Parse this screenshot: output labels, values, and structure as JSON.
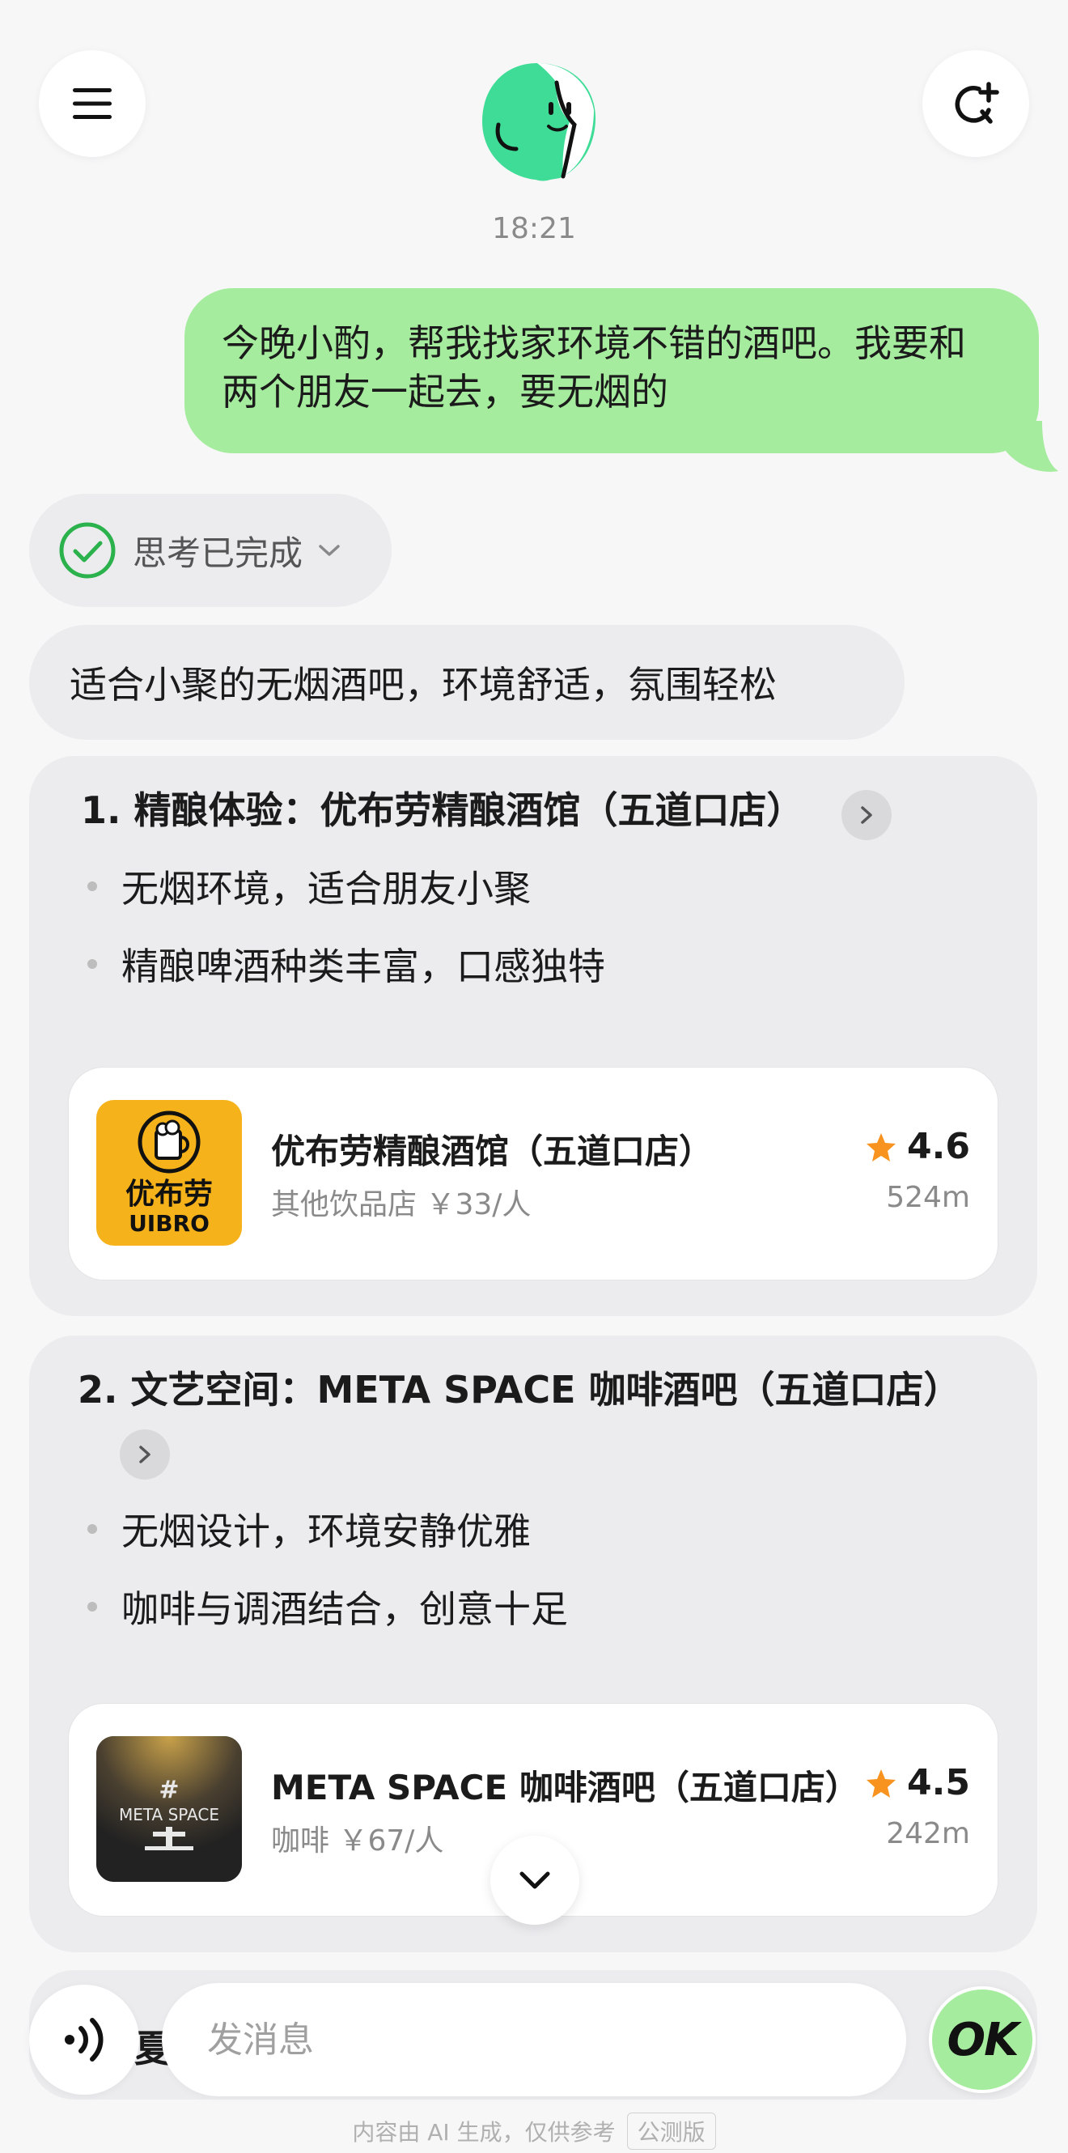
{
  "header": {
    "menu_icon": "hamburger-menu-icon",
    "new_chat_icon": "new-chat-refresh-icon",
    "avatar_icon": "assistant-avatar-icon",
    "timestamp": "18:21"
  },
  "chat": {
    "user_message": "今晚小酌，帮我找家环境不错的酒吧。我要和两个朋友一起去，要无烟的",
    "thinking_status": "思考已完成",
    "summary": "适合小聚的无烟酒吧，环境舒适，氛围轻松",
    "recommendations": [
      {
        "title": "1. 精酿体验：优布劳精酿酒馆（五道口店）",
        "bullets": [
          "无烟环境，适合朋友小聚",
          "精酿啤酒种类丰富，口感独特"
        ],
        "place": {
          "name": "优布劳精酿酒馆（五道口店）",
          "meta": "其他饮品店 ￥33/人",
          "rating": "4.6",
          "distance": "524m",
          "logo_text_cn": "优布劳",
          "logo_text_en": "UIBRO"
        }
      },
      {
        "title_line1": "2. 文艺空间：META SPACE 咖啡酒吧（五道口店）",
        "bullets": [
          "无烟设计，环境安静优雅",
          "咖啡与调酒结合，创意十足"
        ],
        "place": {
          "name": "META SPACE 咖啡酒吧（五道口店）",
          "meta": "咖啡 ￥67/人",
          "rating": "4.5",
          "distance": "242m",
          "logo_text": "META SPACE"
        }
      }
    ],
    "partial_text": "夏"
  },
  "composer": {
    "placeholder": "发消息",
    "send_label": "OK"
  },
  "footer": {
    "disclaimer": "内容由 AI 生成，仅供参考",
    "badge": "公测版"
  },
  "colors": {
    "bubble_green": "#a6ec9e",
    "card_gray": "#ececef",
    "star_orange": "#f7931e",
    "check_green": "#2bb24c"
  }
}
